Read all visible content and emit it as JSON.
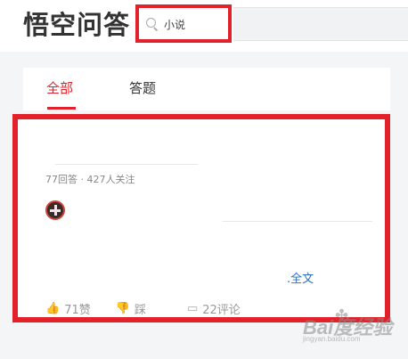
{
  "header": {
    "logo": "悟空问答",
    "search": {
      "value": "小说",
      "icon": "search-icon"
    }
  },
  "tabs": [
    {
      "label": "全部",
      "active": true
    },
    {
      "label": "答题",
      "active": false
    }
  ],
  "question": {
    "meta": "77回答 · 427人关注",
    "read_full_label": "全文",
    "actions": {
      "like_label": "71赞",
      "dislike_label": "踩",
      "comment_label": "22评论"
    }
  },
  "watermark": {
    "main": "Bai度经验",
    "sub": "jingyan.baidu.com"
  },
  "colors": {
    "accent_red": "#e2212b",
    "link_blue": "#2a6fbf"
  }
}
